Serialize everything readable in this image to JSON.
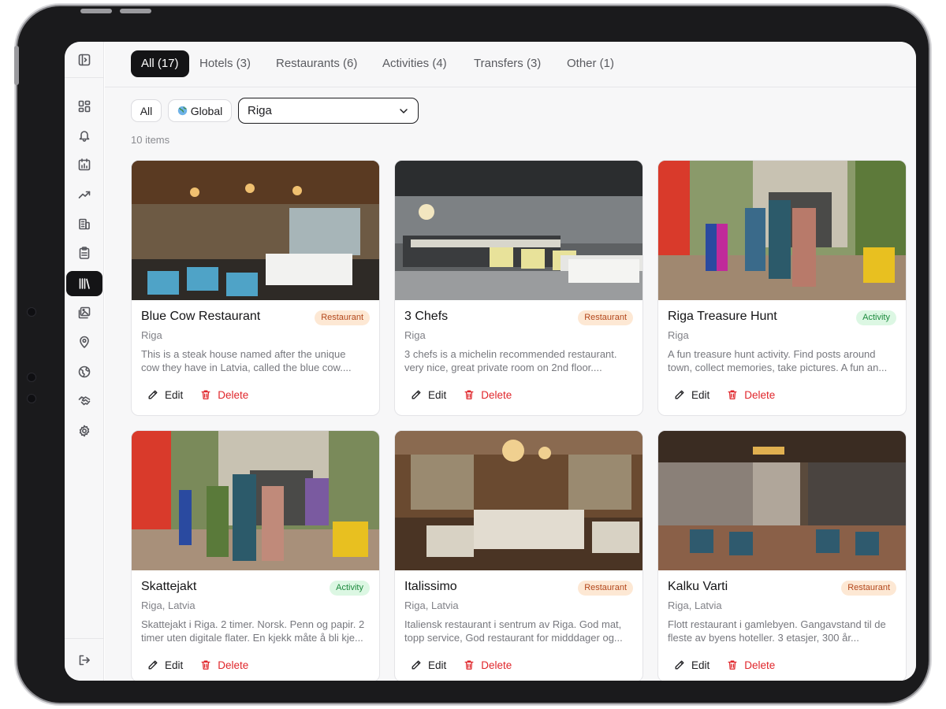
{
  "sidebar": {
    "items": [
      {
        "icon": "dashboard-icon"
      },
      {
        "icon": "bell-icon"
      },
      {
        "icon": "calendar-chart-icon"
      },
      {
        "icon": "trending-up-icon"
      },
      {
        "icon": "building-icon"
      },
      {
        "icon": "clipboard-icon"
      },
      {
        "icon": "library-icon",
        "active": true
      },
      {
        "icon": "image-gallery-icon"
      },
      {
        "icon": "map-pin-icon"
      },
      {
        "icon": "globe-icon"
      },
      {
        "icon": "handshake-icon"
      },
      {
        "icon": "settings-icon"
      }
    ],
    "toggle_icon": "sidebar-toggle-icon",
    "logout_icon": "logout-icon"
  },
  "tabs": [
    {
      "label": "All (17)",
      "active": true
    },
    {
      "label": "Hotels (3)"
    },
    {
      "label": "Restaurants (6)"
    },
    {
      "label": "Activities (4)"
    },
    {
      "label": "Transfers (3)"
    },
    {
      "label": "Other (1)"
    }
  ],
  "filters": {
    "all_label": "All",
    "global_label": "Global",
    "location_value": "Riga"
  },
  "item_count": "10 items",
  "actions": {
    "edit_label": "Edit",
    "delete_label": "Delete"
  },
  "cards": [
    {
      "title": "Blue Cow Restaurant",
      "badge": "Restaurant",
      "location": "Riga",
      "desc1": "This is a steak house named after the unique",
      "desc2": "cow they have in Latvia, called the blue cow...."
    },
    {
      "title": "3 Chefs",
      "badge": "Restaurant",
      "location": "Riga",
      "desc1": "3 chefs is a michelin recommended restaurant.",
      "desc2": "very nice, great private room on 2nd floor...."
    },
    {
      "title": "Riga Treasure Hunt",
      "badge": "Activity",
      "location": "Riga",
      "desc1": "A fun treasure hunt activity. Find posts around",
      "desc2": "town, collect memories, take pictures. A fun an..."
    },
    {
      "title": "Skattejakt",
      "badge": "Activity",
      "location": "Riga, Latvia",
      "desc1": "Skattejakt i Riga. 2 timer. Norsk. Penn og papir. 2",
      "desc2": "timer uten digitale flater. En kjekk måte å bli kje..."
    },
    {
      "title": "Italissimo",
      "badge": "Restaurant",
      "location": "Riga, Latvia",
      "desc1": "Italiensk restaurant i sentrum av Riga. God mat,",
      "desc2": "topp service, God restaurant for midddager og..."
    },
    {
      "title": "Kalku Varti",
      "badge": "Restaurant",
      "location": "Riga, Latvia",
      "desc1": "Flott restaurant i gamlebyen. Gangavstand til de",
      "desc2": "fleste av byens hoteller. 3 etasjer, 300 år..."
    }
  ]
}
